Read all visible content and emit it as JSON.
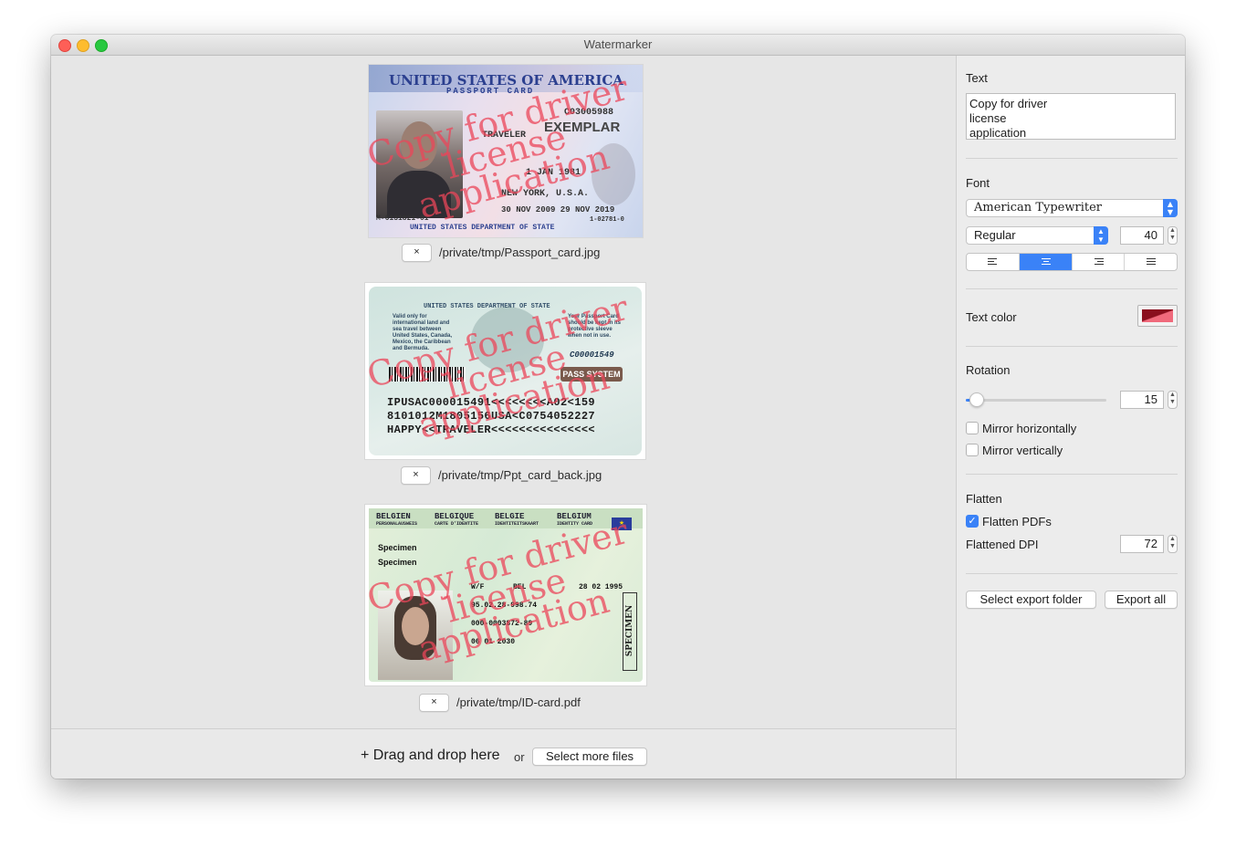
{
  "window": {
    "title": "Watermarker"
  },
  "files": [
    {
      "path": "/private/tmp/Passport_card.jpg",
      "remove_label": "×",
      "card_lines": [
        "UNITED STATES OF AMERICA",
        "PASSPORT CARD",
        "EXEMPLAR",
        "TRAVELER",
        "1 JAN 1981",
        "NEW YORK, U.S.A.",
        "30 NOV 2009   29 NOV 2019",
        "C03005988",
        "UNITED STATES DEPARTMENT OF STATE",
        "M-6131821-01",
        "1-02781-0"
      ]
    },
    {
      "path": "/private/tmp/Ppt_card_back.jpg",
      "remove_label": "×",
      "card_lines": [
        "UNITED STATES DEPARTMENT OF STATE",
        "Valid only for international land and sea travel between United States, Canada, Mexico, the Caribbean and Bermuda.",
        "Your Passport Card should be kept in its protective sleeve when not in use.",
        "C00001549",
        "PASS SYSTEM",
        "IPUSAC000015491<<<<<<<<A02<159",
        "8101012M1805156USA<C0754052227",
        "HAPPY<<TRAVELER<<<<<<<<<<<<<<<"
      ]
    },
    {
      "path": "/private/tmp/ID-card.pdf",
      "remove_label": "×",
      "card_lines": [
        "BELGIEN",
        "BELGIQUE",
        "BELGIE",
        "BELGIUM",
        "PERSONALAUSWEIS",
        "CARTE D'IDENTITE",
        "IDENTITEITSKAART",
        "IDENTITY CARD",
        "Specimen",
        "Specimen",
        "W/F",
        "BEL",
        "28 02 1995",
        "95.02.28-998.74",
        "000-0003872-89",
        "06 01 2030",
        "SPECIMEN"
      ]
    }
  ],
  "watermark_lines": [
    "Copy for driver",
    "license",
    "application"
  ],
  "bottom": {
    "drag_label": "+ Drag and drop here",
    "or_label": "or",
    "select_more": "Select more files"
  },
  "sidebar": {
    "text_label": "Text",
    "text_value": "Copy for driver\nlicense\napplication",
    "font_label": "Font",
    "font_family": "American Typewriter",
    "font_style": "Regular",
    "font_size": "40",
    "alignment_selected": "center",
    "text_color_label": "Text color",
    "text_color": "#8a0f1e",
    "rotation_label": "Rotation",
    "rotation_value": "15",
    "mirror_h_label": "Mirror horizontally",
    "mirror_v_label": "Mirror vertically",
    "flatten_label": "Flatten",
    "flatten_pdfs_label": "Flatten PDFs",
    "flatten_pdfs_checked": true,
    "dpi_label": "Flattened DPI",
    "dpi_value": "72",
    "select_export_label": "Select export folder",
    "export_all_label": "Export all"
  },
  "colors": {
    "accent": "#3a82f7",
    "watermark": "#ec4a5e"
  }
}
